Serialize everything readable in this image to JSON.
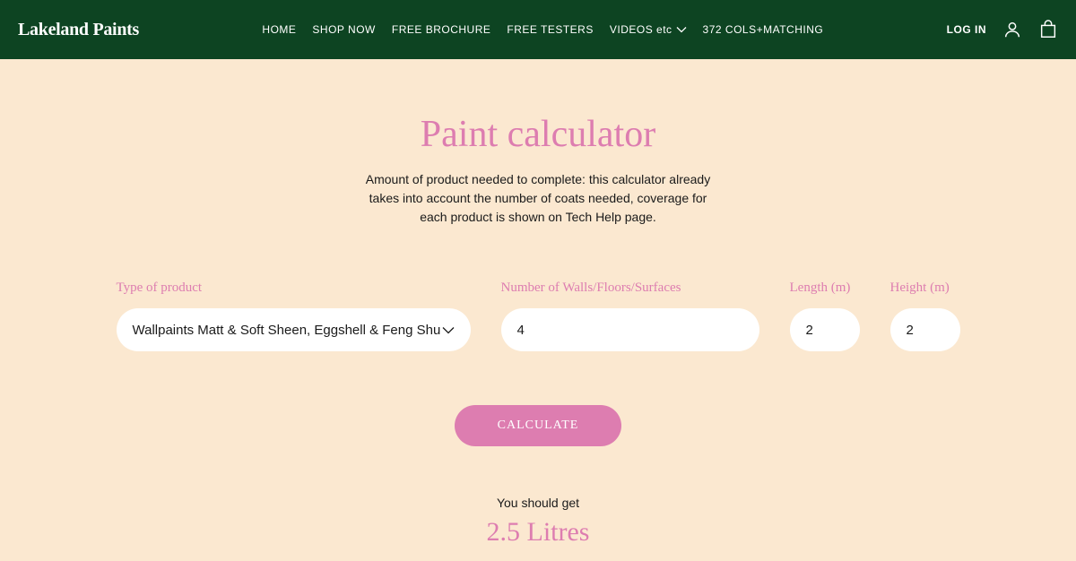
{
  "header": {
    "logo": "Lakeland Paints",
    "nav": {
      "home": "HOME",
      "shop": "SHOP NOW",
      "brochure": "FREE BROCHURE",
      "testers": "FREE TESTERS",
      "videos": "VIDEOS etc",
      "cols": "372 COLS+MATCHING"
    },
    "login": "LOG IN"
  },
  "main": {
    "title": "Paint calculator",
    "subtitle": "Amount of product needed to complete: this calculator already takes into account the number of coats needed, coverage for each product is shown on Tech Help page.",
    "labels": {
      "product": "Type of product",
      "surfaces": "Number of Walls/Floors/Surfaces",
      "length": "Length (m)",
      "height": "Height (m)"
    },
    "values": {
      "product": "Wallpaints Matt & Soft Sheen, Eggshell & Feng Shu",
      "surfaces": "4",
      "length": "2",
      "height": "2"
    },
    "calc_button": "CALCULATE",
    "result_label": "You should get",
    "result_value": "2.5 Litres"
  }
}
